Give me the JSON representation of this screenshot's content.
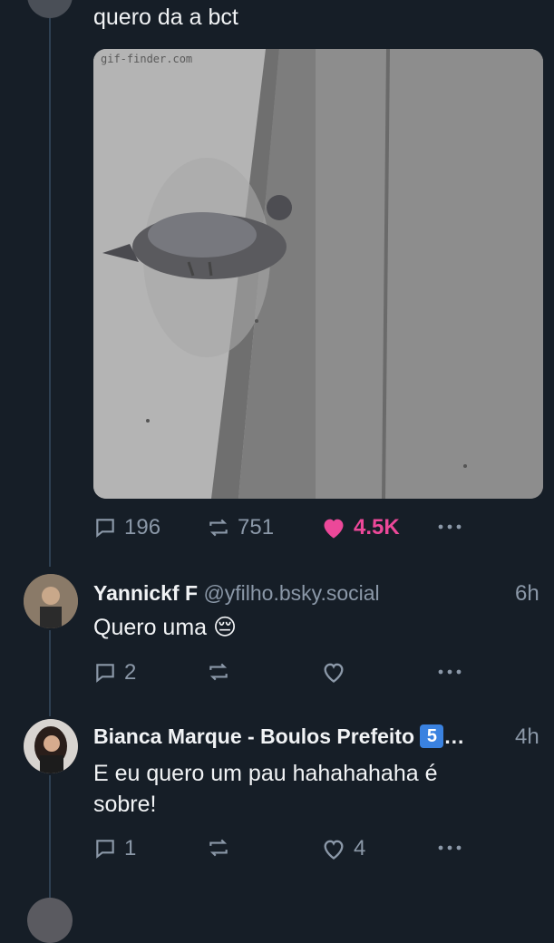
{
  "top_post": {
    "text": "quero da a bct",
    "media_watermark": "gif-finder.com",
    "actions": {
      "replies": "196",
      "reposts": "751",
      "likes": "4.5K",
      "like_color": "#ec4899"
    }
  },
  "replies": [
    {
      "display_name": "Yannickf F",
      "handle": "@yfilho.bsky.social",
      "time": "6h",
      "text": "Quero uma 😔",
      "reply_count": "2",
      "repost_count": "",
      "like_count": ""
    },
    {
      "display_name": "Bianca Marque - Boulos Prefeito",
      "badge": "5",
      "ellipsis": "…",
      "time": "4h",
      "text_line1": "E eu quero um pau hahahahaha é",
      "text_line2": "sobre!",
      "reply_count": "1",
      "repost_count": "",
      "like_count": "4"
    }
  ],
  "icons": [
    "reply-icon",
    "repost-icon",
    "like-icon",
    "more-icon"
  ]
}
